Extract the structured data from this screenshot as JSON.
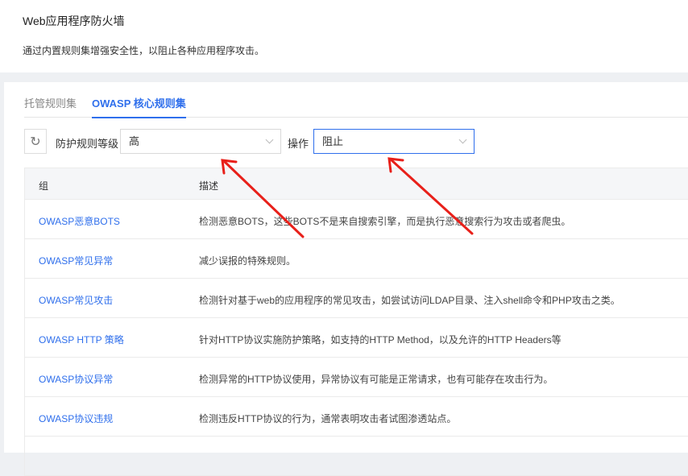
{
  "header": {
    "title": "Web应用程序防火墙",
    "description": "通过内置规则集增强安全性，以阻止各种应用程序攻击。"
  },
  "tabs": [
    {
      "label": "托管规则集",
      "active": false
    },
    {
      "label": "OWASP 核心规则集",
      "active": true
    }
  ],
  "toolbar": {
    "refresh_icon": "refresh-icon",
    "level_label": "防护规则等级",
    "level_value": "高",
    "action_label": "操作",
    "action_value": "阻止"
  },
  "table": {
    "columns": [
      "组",
      "描述"
    ],
    "rows": [
      {
        "group": "OWASP恶意BOTS",
        "desc": "检测恶意BOTS，这些BOTS不是来自搜索引擎，而是执行恶意搜索行为攻击或者爬虫。"
      },
      {
        "group": "OWASP常见异常",
        "desc": "减少误报的特殊规则。"
      },
      {
        "group": "OWASP常见攻击",
        "desc": "检测针对基于web的应用程序的常见攻击，如尝试访问LDAP目录、注入shell命令和PHP攻击之类。"
      },
      {
        "group": "OWASP HTTP 策略",
        "desc": "针对HTTP协议实施防护策略，如支持的HTTP Method，以及允许的HTTP Headers等"
      },
      {
        "group": "OWASP协议异常",
        "desc": "检测异常的HTTP协议使用，异常协议有可能是正常请求，也有可能存在攻击行为。"
      },
      {
        "group": "OWASP协议违规",
        "desc": "检测违反HTTP协议的行为，通常表明攻击者试图渗透站点。"
      },
      {
        "group": "",
        "desc": ""
      }
    ]
  },
  "colors": {
    "accent": "#2f6fec",
    "annotation": "#e8201a"
  }
}
